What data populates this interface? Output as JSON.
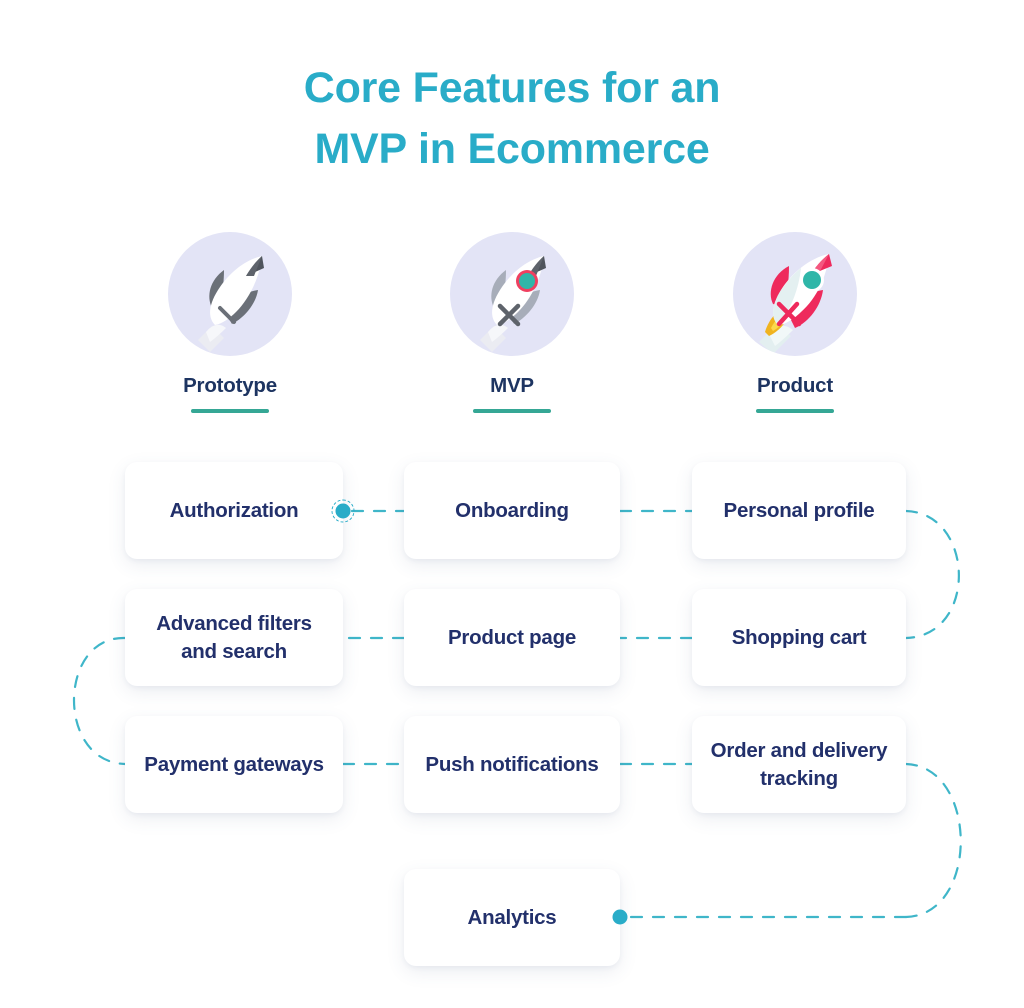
{
  "title": {
    "line1": "Core Features for an",
    "line2": "MVP in Ecommerce",
    "color": "#29acc8"
  },
  "stages": [
    {
      "id": "prototype",
      "label": "Prototype",
      "icon": "rocket-grayscale-icon",
      "circle_color": "#e3e4f6",
      "underline_color": "#35a795"
    },
    {
      "id": "mvp",
      "label": "MVP",
      "icon": "rocket-porthole-icon",
      "circle_color": "#e3e4f6",
      "underline_color": "#35a795"
    },
    {
      "id": "product",
      "label": "Product",
      "icon": "rocket-colored-icon",
      "circle_color": "#e3e4f6",
      "underline_color": "#35a795"
    }
  ],
  "rows": [
    {
      "id": "row-1",
      "cards": [
        {
          "id": "authorization",
          "label": "Authorization",
          "column": "prototype"
        },
        {
          "id": "onboarding",
          "label": "Onboarding",
          "column": "mvp"
        },
        {
          "id": "personal-profile",
          "label": "Personal profile",
          "column": "product"
        }
      ]
    },
    {
      "id": "row-2",
      "cards": [
        {
          "id": "advanced-filters-and-search",
          "label": "Advanced filters and search",
          "column": "prototype"
        },
        {
          "id": "product-page",
          "label": "Product page",
          "column": "mvp"
        },
        {
          "id": "shopping-cart",
          "label": "Shopping cart",
          "column": "product"
        }
      ]
    },
    {
      "id": "row-3",
      "cards": [
        {
          "id": "payment-gateways",
          "label": "Payment gateways",
          "column": "prototype"
        },
        {
          "id": "push-notifications",
          "label": "Push notifications",
          "column": "mvp"
        },
        {
          "id": "order-and-delivery-tracking",
          "label": "Order and delivery tracking",
          "column": "product"
        }
      ]
    },
    {
      "id": "row-4",
      "cards": [
        {
          "id": "analytics",
          "label": "Analytics",
          "column": "mvp"
        }
      ]
    }
  ],
  "connectors": {
    "line_color": "#3fb6c9",
    "node_color": "#29acc8",
    "start_node": {
      "label": "authorization-endpoint",
      "ringed": true
    },
    "end_node": {
      "label": "analytics-endpoint",
      "ringed": false
    }
  },
  "card_text": {
    "authorization": "Authorization",
    "onboarding": "Onboarding",
    "personal_profile": "Personal profile",
    "advanced_filters": "Advanced filters<br>and search",
    "product_page": "Product page",
    "shopping_cart": "Shopping cart",
    "payment_gateways": "Payment gateways",
    "push_notifications": "Push notifications",
    "order_tracking": "Order and delivery<br>tracking",
    "analytics": "Analytics"
  }
}
